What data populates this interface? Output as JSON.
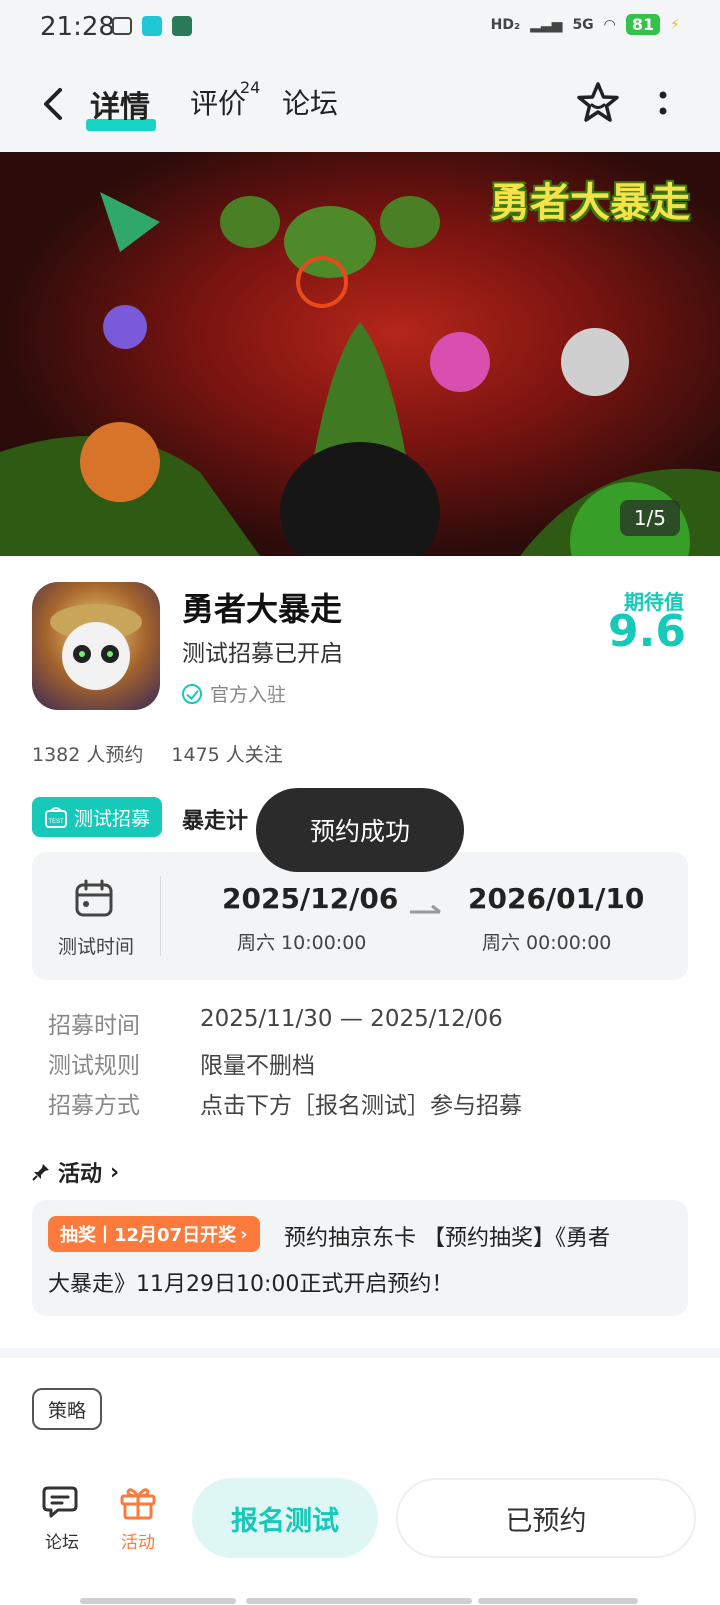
{
  "status_bar": {
    "time": "21:28",
    "left_icons": [
      "app-icon",
      "top-icon",
      "avatar-icon"
    ],
    "network": "5G",
    "hd_label": "HD₂",
    "battery": "81"
  },
  "nav": {
    "tabs": [
      {
        "label": "详情",
        "active": true
      },
      {
        "label": "评价",
        "badge": "24"
      },
      {
        "label": "论坛"
      }
    ],
    "back_icon": "back-arrow-icon",
    "favorite_icon": "star-icon",
    "more_icon": "more-vertical-icon"
  },
  "banner": {
    "logo_text": "勇者大暴走",
    "counter": "1/5"
  },
  "game": {
    "title": "勇者大暴走",
    "subtitle": "测试招募已开启",
    "official": "官方入驻",
    "expect_label": "期待值",
    "expect_value": "9.6",
    "reservations": "1382 人预约",
    "followers": "1475 人关注"
  },
  "test": {
    "badge_label": "测试招募",
    "plan_text": "暴走计",
    "time_label": "测试时间",
    "start_date": "2025/12/06",
    "start_time": "周六  10:00:00",
    "end_date": "2026/01/10",
    "end_time": "周六  00:00:00"
  },
  "toast": "预约成功",
  "info": [
    {
      "label": "招募时间",
      "value": "2025/11/30 — 2025/12/06"
    },
    {
      "label": "测试规则",
      "value": "限量不删档"
    },
    {
      "label": "招募方式",
      "value": "点击下方［报名测试］参与招募"
    }
  ],
  "activity": {
    "title": "活动",
    "tag": "抽奖丨12月07日开奖",
    "text_line1": "预约抽京东卡 【预约抽奖】《勇者",
    "text_line2": "大暴走》11月29日10:00正式开启预约！"
  },
  "strategy_label": "策略",
  "bottom": {
    "forum_label": "论坛",
    "activity_label": "活动",
    "signup_label": "报名测试",
    "reserved_label": "已预约"
  },
  "colors": {
    "accent": "#16c9b8",
    "orange": "#fb7a3c",
    "toast_bg": "#2b2b2b"
  }
}
